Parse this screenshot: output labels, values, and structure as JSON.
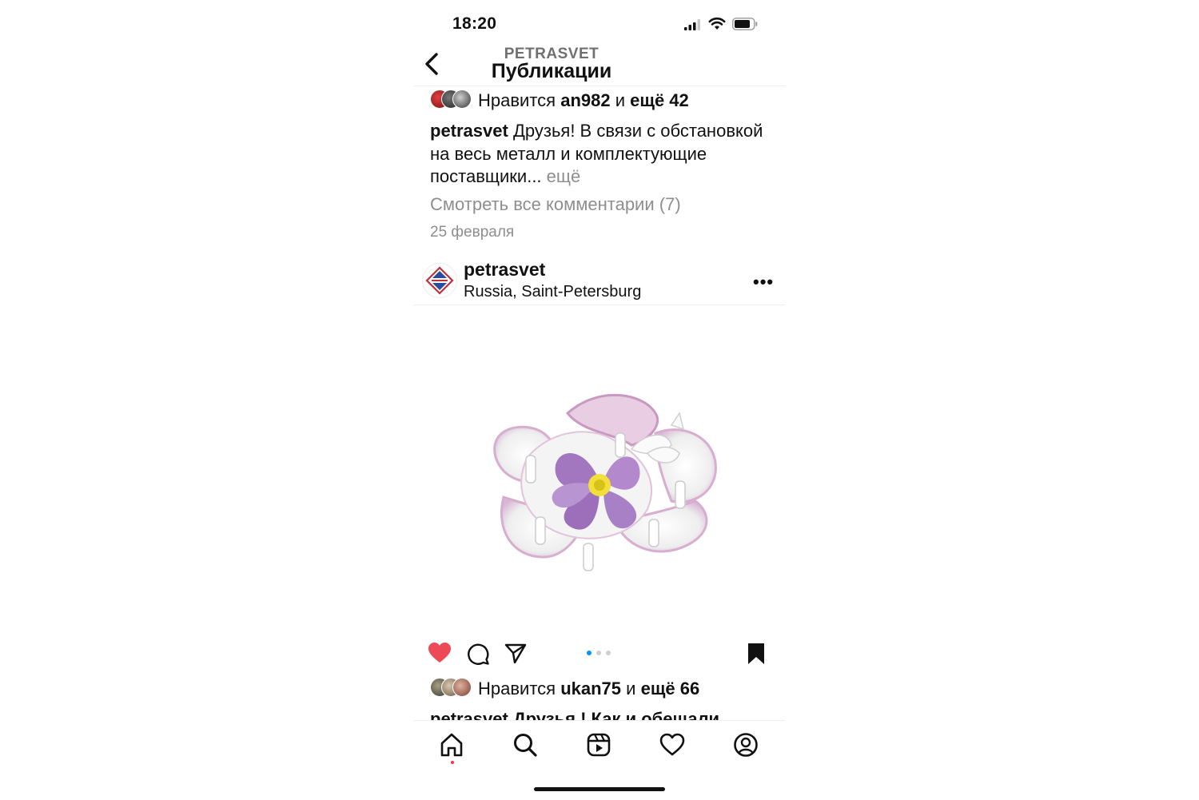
{
  "status_bar": {
    "time": "18:20"
  },
  "header": {
    "subtitle": "PETRASVET",
    "title": "Публикации"
  },
  "prev_post": {
    "likes": {
      "prefix": "Нравится",
      "user": "an982",
      "conj": "и",
      "others": "ещё 42"
    },
    "caption": {
      "user": "petrasvet",
      "text": "Друзья! В связи с обстановкой на весь металл и комплектующие поставщики...",
      "more": "ещё"
    },
    "view_comments": "Смотреть все комментарии (7)",
    "date": "25 февраля"
  },
  "post": {
    "user": "petrasvet",
    "location": "Russia, Saint-Petersburg",
    "menu_icon": "more-horizontal-icon",
    "image": "flower-shaped-chandelier-photo",
    "liked": true,
    "carousel": {
      "total": 3,
      "active": 1
    },
    "likes": {
      "prefix": "Нравится",
      "user": "ukan75",
      "conj": "и",
      "others": "ещё 66"
    },
    "caption_cut": "petrasvet Друзья ! Как и обещали"
  },
  "tabbar": {
    "items": [
      "home-icon",
      "search-icon",
      "reels-icon",
      "heart-icon",
      "profile-icon"
    ],
    "active": "home-icon"
  },
  "colors": {
    "like_red": "#ed4956",
    "active_dot": "#0095f6",
    "muted_text": "#8e8e8e"
  }
}
